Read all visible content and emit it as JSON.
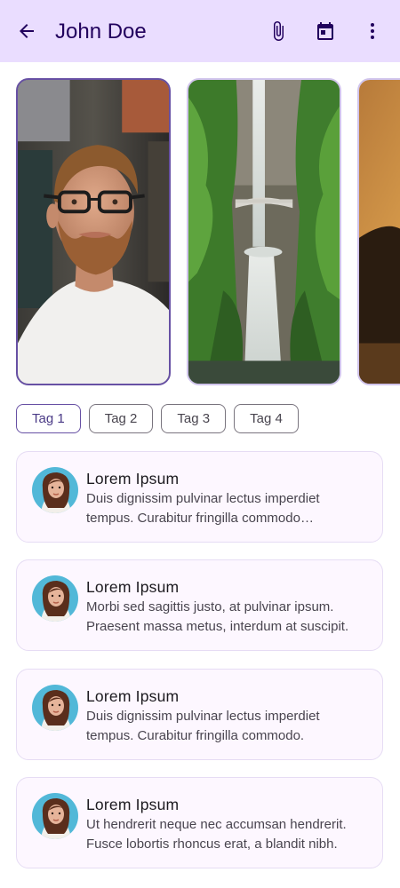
{
  "app_bar": {
    "title": "John Doe",
    "icons": [
      "arrow-back-icon",
      "attachment-icon",
      "calendar-icon",
      "more-vert-icon"
    ]
  },
  "carousel": {
    "items": [
      {
        "subject": "portrait",
        "selected": true
      },
      {
        "subject": "waterfall",
        "selected": false
      },
      {
        "subject": "sunset",
        "selected": false
      }
    ]
  },
  "tags": [
    {
      "label": "Tag 1",
      "selected": true
    },
    {
      "label": "Tag 2",
      "selected": false
    },
    {
      "label": "Tag 3",
      "selected": false
    },
    {
      "label": "Tag 4",
      "selected": false
    }
  ],
  "list": [
    {
      "title": "Lorem Ipsum",
      "text": "Duis dignissim pulvinar lectus imperdiet tempus. Curabitur fringilla commodo consequat."
    },
    {
      "title": "Lorem Ipsum",
      "text": "Morbi sed sagittis justo, at pulvinar ipsum. Praesent massa metus, interdum at suscipit."
    },
    {
      "title": "Lorem Ipsum",
      "text": "Duis dignissim pulvinar lectus imperdiet tempus. Curabitur fringilla commodo."
    },
    {
      "title": "Lorem Ipsum",
      "text": "Ut hendrerit neque nec accumsan hendrerit. Fusce lobortis rhoncus erat, a blandit nibh."
    }
  ],
  "colors": {
    "app_bar_bg": "#eaddff",
    "primary": "#6750a4",
    "card_bg": "#fdf7ff",
    "card_border": "#e6dcf4"
  }
}
